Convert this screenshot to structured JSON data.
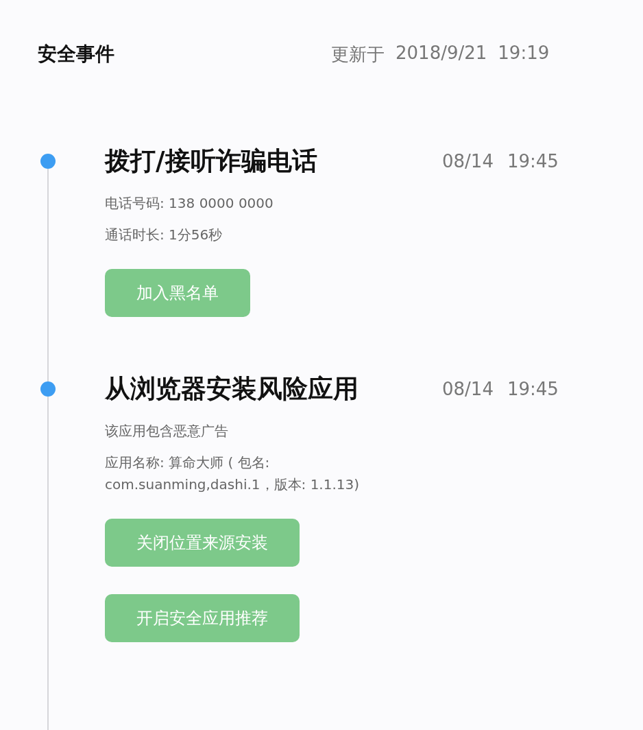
{
  "header": {
    "title": "安全事件",
    "updated_label": "更新于",
    "updated_date": "2018/9/21",
    "updated_time": "19:19"
  },
  "events": [
    {
      "title": "拨打/接听诈骗电话",
      "date": "08/14",
      "time": "19:45",
      "details": [
        "电话号码: 138 0000 0000",
        "通话时长: 1分56秒"
      ],
      "buttons": [
        "加入黑名单"
      ]
    },
    {
      "title": "从浏览器安装风险应用",
      "date": "08/14",
      "time": "19:45",
      "details": [
        "该应用包含恶意广告",
        "应用名称: 算命大师 ( 包名: com.suanming,dashi.1，版本: 1.1.13)"
      ],
      "buttons": [
        "关闭位置来源安装",
        "开启安全应用推荐"
      ]
    }
  ]
}
